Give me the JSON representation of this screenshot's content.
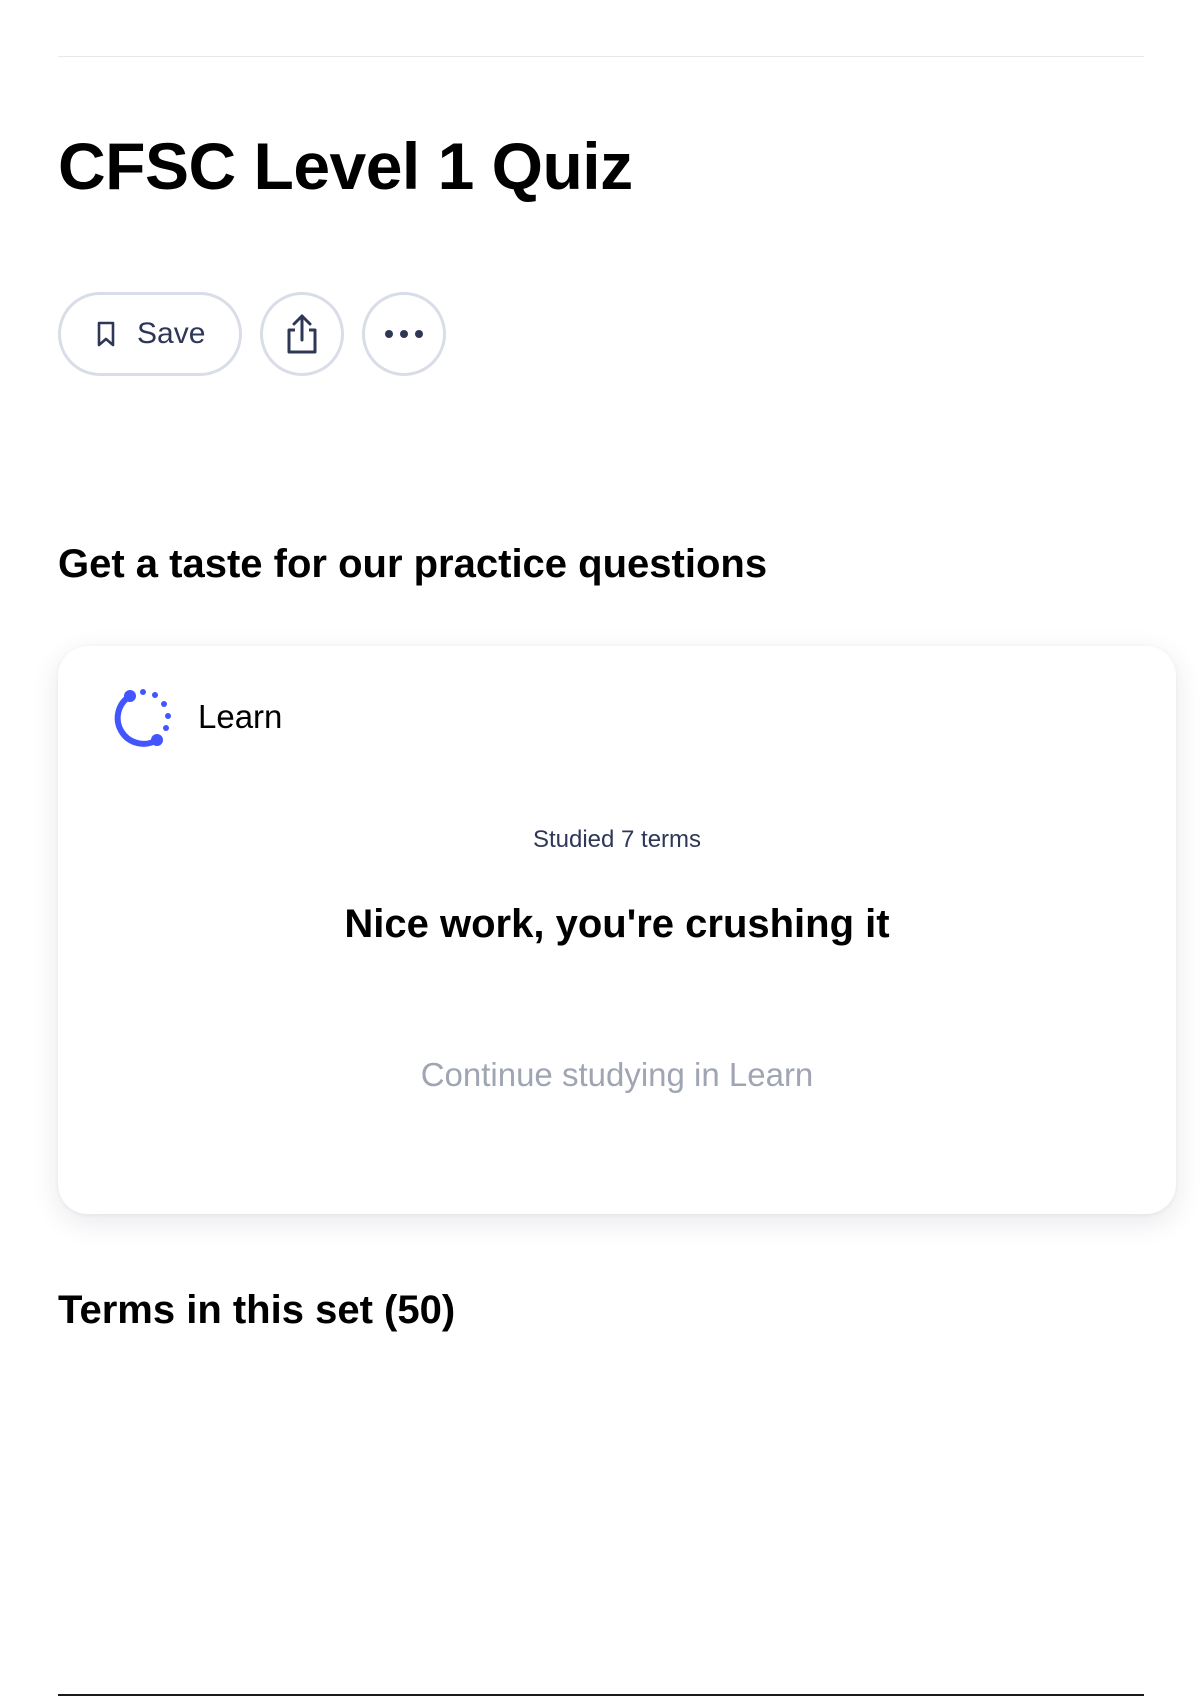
{
  "header": {
    "title": "CFSC Level 1 Quiz"
  },
  "actions": {
    "save_label": "Save",
    "save_icon": "bookmark-icon",
    "share_icon": "share-icon",
    "more_icon": "more-horizontal-icon"
  },
  "practice": {
    "heading": "Get a taste for our practice questions",
    "card": {
      "mode_label": "Learn",
      "mode_icon": "learn-progress-icon",
      "studied_text": "Studied 7 terms",
      "message": "Nice work, you're crushing it",
      "continue_label": "Continue studying in Learn"
    }
  },
  "terms": {
    "heading": "Terms in this set (50)"
  },
  "colors": {
    "accent": "#4255ff",
    "text_primary": "#000000",
    "text_secondary": "#2e3856",
    "text_muted": "#a0a5b3",
    "border": "#d9dde8"
  }
}
